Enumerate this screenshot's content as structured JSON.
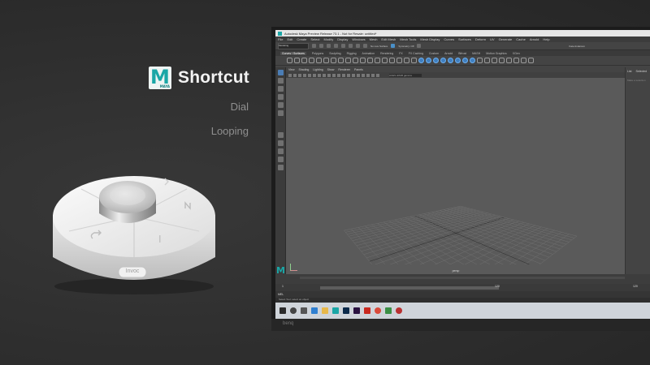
{
  "brand": {
    "title": "Shortcut",
    "logo_letter": "M",
    "logo_tag": "MAYA"
  },
  "features": [
    "Dial",
    "Looping"
  ],
  "device": {
    "button_label": "Invoc"
  },
  "monitor": {
    "brand_text": "benq"
  },
  "maya": {
    "window_title": "Autodesk Maya Preview Release 73.1 - Not for Resale: untitled*",
    "menu": [
      "File",
      "Edit",
      "Create",
      "Select",
      "Modify",
      "Display",
      "Windows",
      "Mesh",
      "Edit Mesh",
      "Mesh Tools",
      "Mesh Display",
      "Curves",
      "Surfaces",
      "Deform",
      "UV",
      "Generate",
      "Cache",
      "Arnold",
      "Help"
    ],
    "workspace": "Modeling",
    "no_live": "No Live Surface",
    "symmetry": "Symmetry: Off",
    "user": "Kate Anderson",
    "shelf_tabs": [
      "Curves / Surfaces",
      "Polygons",
      "Sculpting",
      "Rigging",
      "Animation",
      "Rendering",
      "FX",
      "FX Caching",
      "Custom",
      "Arnold",
      "Bifrost",
      "MASH",
      "Motion Graphics",
      "XGen"
    ],
    "active_shelf_tab": "Curves / Surfaces",
    "viewport_menu": [
      "View",
      "Shading",
      "Lighting",
      "Show",
      "Renderer",
      "Panels"
    ],
    "color_space": "ACES sRGB gamma",
    "camera": "persp",
    "attr_tabs": [
      "List",
      "Selected"
    ],
    "attr_hint": "Make a selection",
    "range_start": "1",
    "range_mid": "120",
    "range_end": "120",
    "cmd_label": "MEL",
    "help_text": "Select Tool: select an object"
  },
  "colors": {
    "maya_teal": "#1aa6a6",
    "accent_blue": "#4a90c8"
  }
}
